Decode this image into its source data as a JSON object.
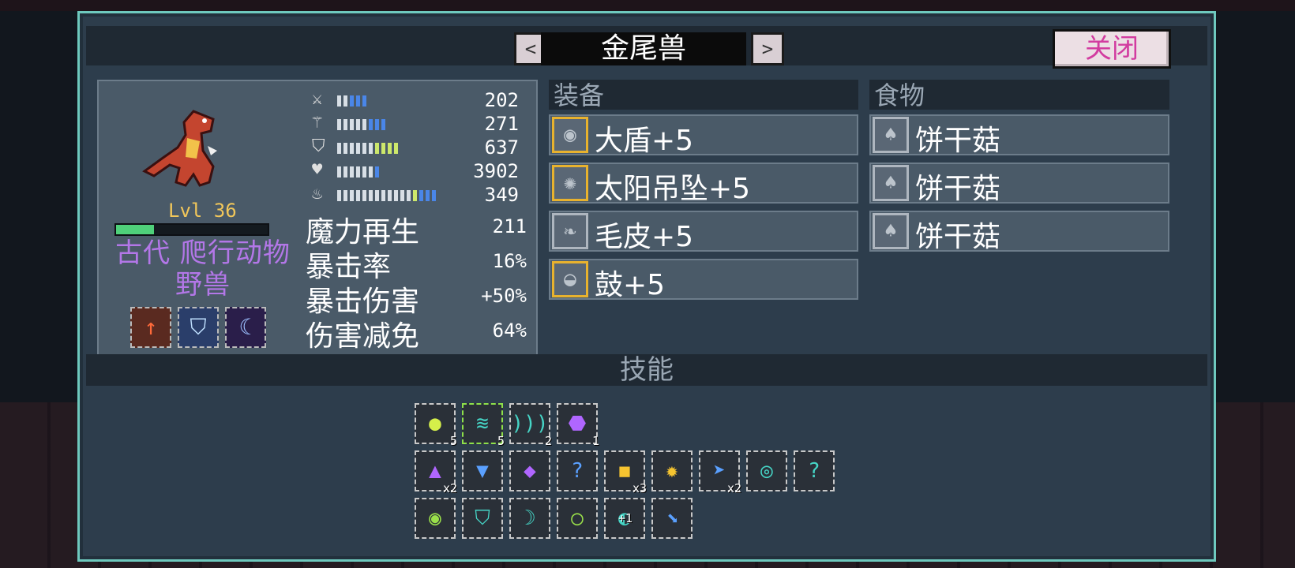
{
  "header": {
    "title": "金尾兽",
    "prev_glyph": "<",
    "next_glyph": ">",
    "close_label": "关闭"
  },
  "creature": {
    "level": "Lvl 36",
    "hp_fraction": 0.25,
    "name": "古代 爬行动物 野兽",
    "traits": [
      "attack-up-icon",
      "staff-shield-icon",
      "moon-icon"
    ]
  },
  "stats": [
    {
      "icon": "sword-icon",
      "value": "202",
      "pips": "wwbbb"
    },
    {
      "icon": "staff-icon",
      "value": "271",
      "pips": "wwwwwbbb"
    },
    {
      "icon": "shield-icon",
      "value": "637",
      "pips": "wwwwwwgggg"
    },
    {
      "icon": "heart-icon",
      "value": "3902",
      "pips": "wwwwwwb"
    },
    {
      "icon": "mana-flask-icon",
      "value": "349",
      "pips": "wwwwwwwwwwwwgbbb"
    }
  ],
  "big_stats": [
    {
      "label": "魔力再生",
      "value": "211"
    },
    {
      "label": "暴击率",
      "value": "16%"
    },
    {
      "label": "暴击伤害",
      "value": "+50%"
    },
    {
      "label": "伤害减免",
      "value": "64%"
    }
  ],
  "equipment": {
    "heading": "装备",
    "items": [
      {
        "label": "大盾+5",
        "icon": "shield-round-icon"
      },
      {
        "label": "太阳吊坠+5",
        "icon": "sun-pendant-icon"
      },
      {
        "label": "毛皮+5",
        "icon": "fur-icon"
      },
      {
        "label": "鼓+5",
        "icon": "drum-icon"
      }
    ]
  },
  "food": {
    "heading": "食物",
    "items": [
      {
        "label": "饼干菇",
        "icon": "mushroom-icon"
      },
      {
        "label": "饼干菇",
        "icon": "mushroom-icon"
      },
      {
        "label": "饼干菇",
        "icon": "mushroom-icon"
      }
    ]
  },
  "skills": {
    "heading": "技能",
    "row1": [
      {
        "icon": "slime-shield-icon",
        "count": "5"
      },
      {
        "icon": "wind-slash-icon",
        "count": "5"
      },
      {
        "icon": "wave-icon",
        "count": "2"
      },
      {
        "icon": "purple-feather-icon",
        "count": "1"
      }
    ],
    "row2": [
      {
        "icon": "purple-up-icon",
        "count": "x2"
      },
      {
        "icon": "blue-gem-icon",
        "count": ""
      },
      {
        "icon": "purple-gem-icon",
        "count": ""
      },
      {
        "icon": "unknown-icon",
        "count": ""
      },
      {
        "icon": "gold-bar-icon",
        "count": "x3"
      },
      {
        "icon": "sunburst-icon",
        "count": ""
      },
      {
        "icon": "blue-fish-icon",
        "count": "x2"
      },
      {
        "icon": "teal-ring-icon",
        "count": ""
      },
      {
        "icon": "unknown-icon",
        "count": ""
      }
    ],
    "row3": [
      {
        "icon": "green-orb-icon",
        "count": ""
      },
      {
        "icon": "shield-ring-icon",
        "count": ""
      },
      {
        "icon": "teal-crescent-icon",
        "count": ""
      },
      {
        "icon": "green-ring-icon",
        "count": ""
      },
      {
        "icon": "plus-one-icon",
        "count": "+1"
      },
      {
        "icon": "blue-arrow-icon",
        "count": ""
      }
    ]
  }
}
